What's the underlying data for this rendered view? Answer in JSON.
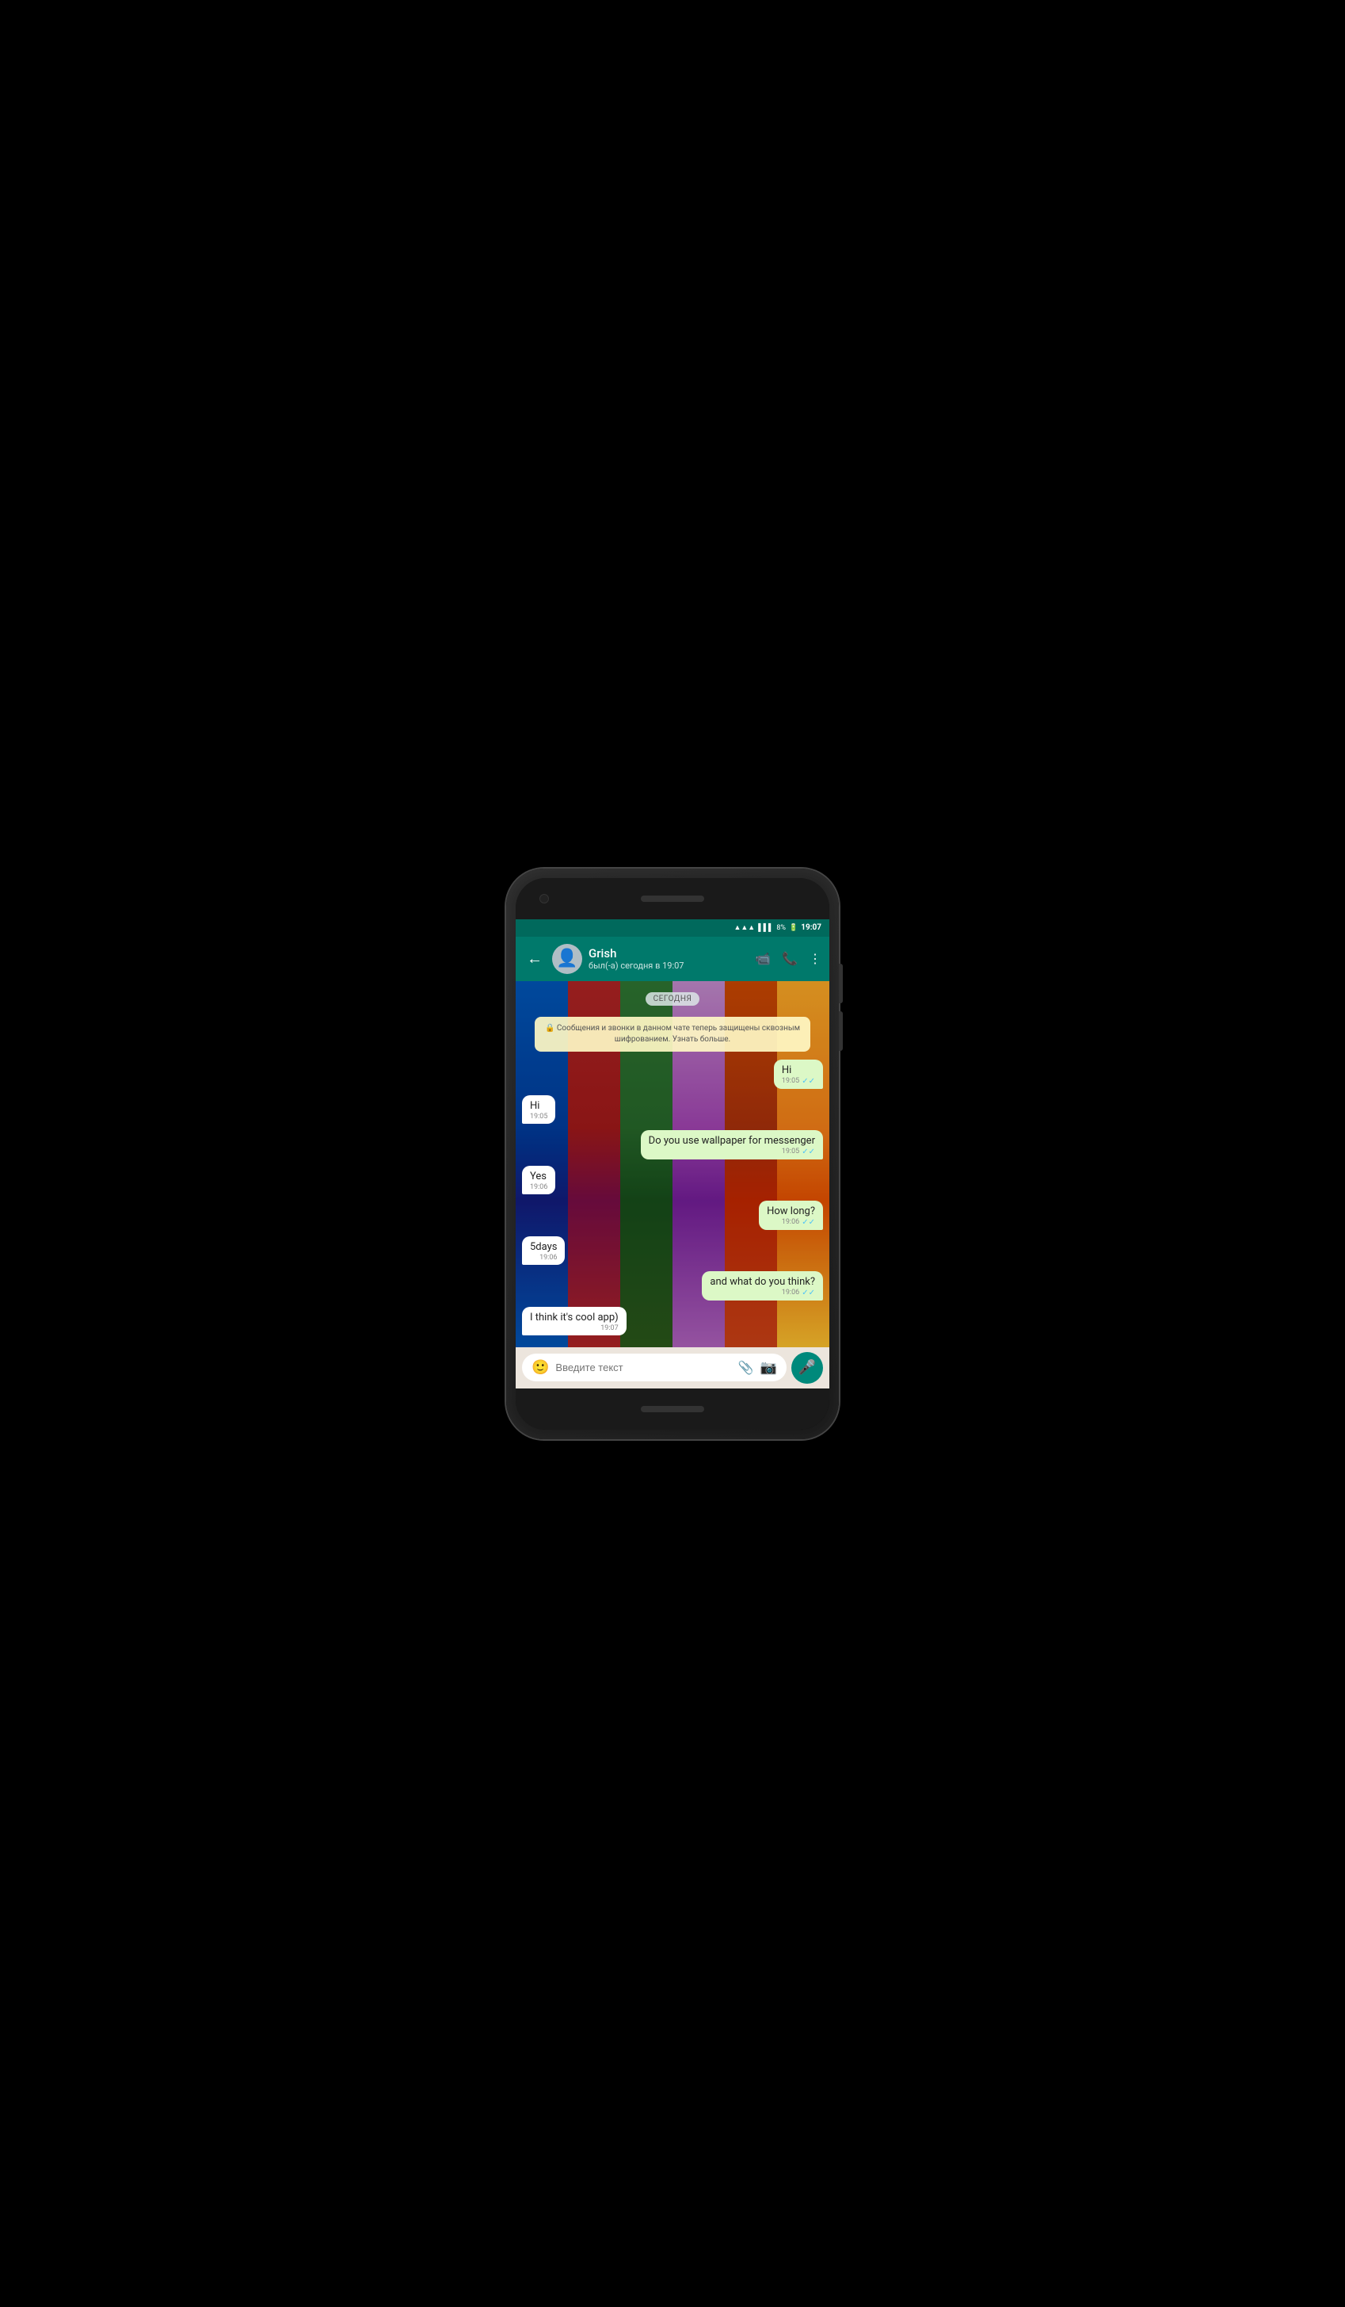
{
  "status_bar": {
    "wifi_icon": "📶",
    "signal_icon": "📶",
    "battery": "8%",
    "time": "19:07"
  },
  "header": {
    "back_label": "←",
    "contact_name": "Grish",
    "contact_status": "был(-а) сегодня в 19:07",
    "video_icon": "🎥",
    "call_icon": "📞",
    "more_icon": "⋮"
  },
  "date_badge": "СЕГОДНЯ",
  "system_message": "🔒 Сообщения и звонки в данном чате теперь защищены сквозным шифрованием. Узнать больше.",
  "messages": [
    {
      "id": 1,
      "type": "sent",
      "text": "Hi",
      "time": "19:05",
      "checks": true
    },
    {
      "id": 2,
      "type": "received",
      "text": "Hi",
      "time": "19:05",
      "checks": false
    },
    {
      "id": 3,
      "type": "sent",
      "text": "Do you use wallpaper for messenger",
      "time": "19:05",
      "checks": true
    },
    {
      "id": 4,
      "type": "received",
      "text": "Yes",
      "time": "19:06",
      "checks": false
    },
    {
      "id": 5,
      "type": "sent",
      "text": "How long?",
      "time": "19:06",
      "checks": true
    },
    {
      "id": 6,
      "type": "received",
      "text": "5days",
      "time": "19:06",
      "checks": false
    },
    {
      "id": 7,
      "type": "sent",
      "text": "and what do you think?",
      "time": "19:06",
      "checks": true
    },
    {
      "id": 8,
      "type": "received",
      "text": "I think it's cool app)",
      "time": "19:07",
      "checks": false
    }
  ],
  "input": {
    "placeholder": "Введите текст"
  },
  "wallpaper": {
    "planks": [
      {
        "color": "#1565c0"
      },
      {
        "color": "#c62828"
      },
      {
        "color": "#e65100"
      },
      {
        "color": "#ad1457"
      },
      {
        "color": "#6a1fa0"
      },
      {
        "color": "#f9a825"
      }
    ]
  }
}
